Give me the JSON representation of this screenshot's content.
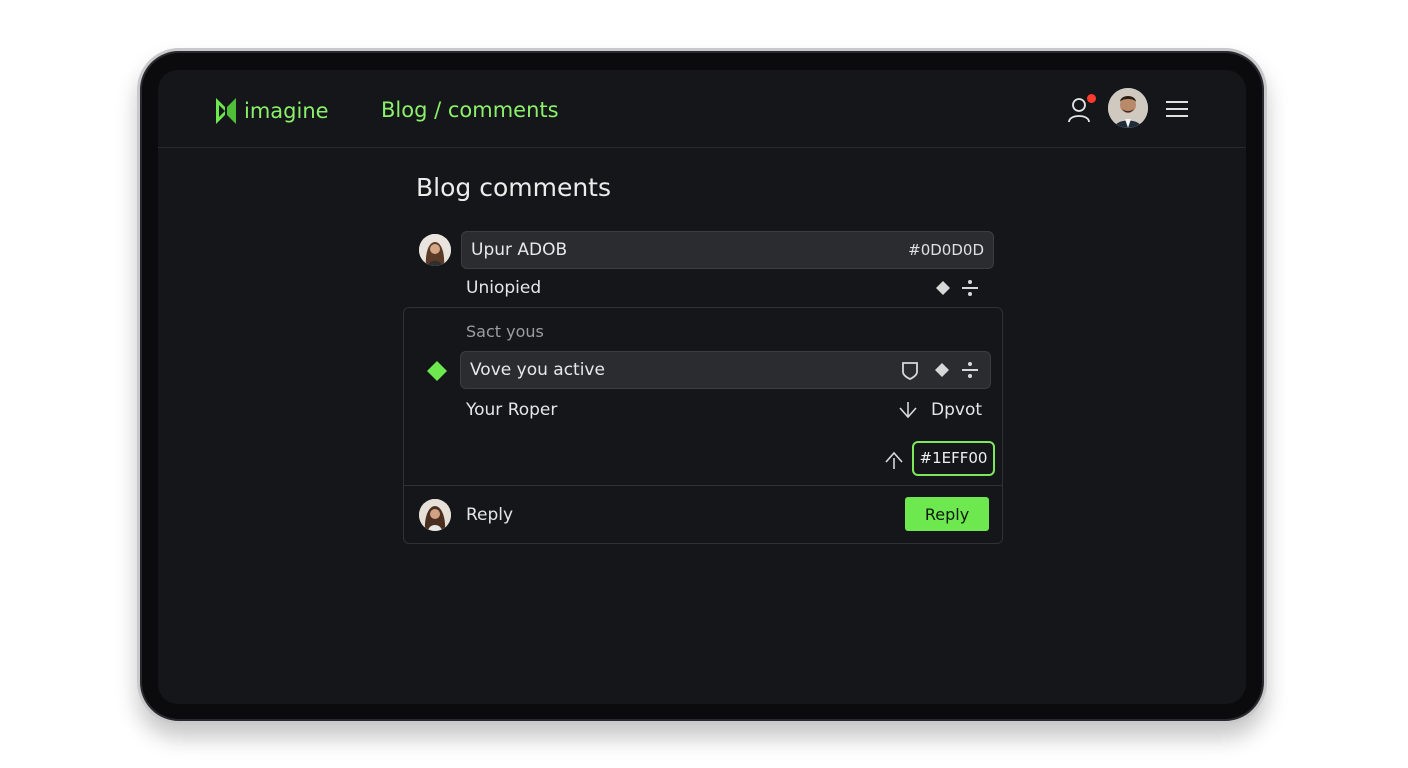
{
  "header": {
    "logo_text": "imagine",
    "breadcrumb": "Blog / comments"
  },
  "page": {
    "title": "Blog comments"
  },
  "comment": {
    "input_value": "Upur ADOB",
    "input_right_value": "#0D0D0D",
    "status_label": "Uniopied"
  },
  "panel": {
    "section_label": "Sact yous",
    "active_field_value": "Vove you active",
    "reply_label": "Your Roper",
    "downvote_label": "Dpvot",
    "highlight_value": "#1EFF00"
  },
  "footer": {
    "reply_label": "Reply",
    "reply_button_label": "Reply"
  },
  "colors": {
    "accent": "#6de84f",
    "screen_bg": "#141619",
    "field_bg": "#2a2c30",
    "notification": "#ff3b30"
  },
  "icons": [
    "logo-mark-icon",
    "user-icon",
    "notification-dot",
    "menu-icon",
    "diamond-icon",
    "sort-icon",
    "shield-icon",
    "arrow-down-icon",
    "arrow-up-icon",
    "green-diamond-icon"
  ]
}
